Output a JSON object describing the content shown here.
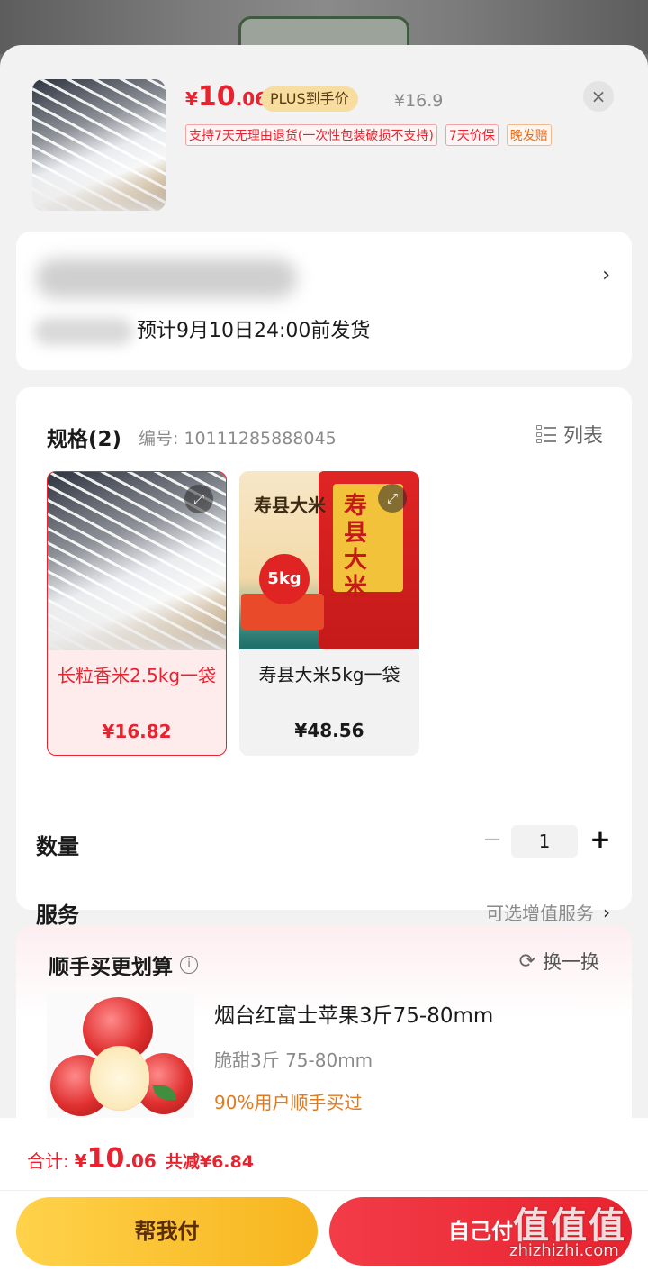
{
  "header": {
    "price_symbol": "¥",
    "price_int": "10",
    "price_dec": ".06",
    "plus_tag": "PLUS到手价",
    "original_price": "¥16.9",
    "close_icon": "×",
    "service_tags": [
      "支持7天无理由退货(一次性包装破损不支持)",
      "7天价保",
      "晚发赔"
    ]
  },
  "address": {
    "shipping_note": "预计9月10日24:00前发货"
  },
  "spec": {
    "title": "规格(2)",
    "code": "编号: 10111285888045",
    "list_label": "列表",
    "options": [
      {
        "name": "长粒香米2.5kg一袋",
        "price": "¥16.82",
        "selected": true
      },
      {
        "name": "寿县大米5kg一袋",
        "price": "¥48.56",
        "selected": false
      }
    ],
    "bag_text_a": "寿县大米",
    "bag_text_b": "寿县大米",
    "bag_weight": "5kg"
  },
  "quantity": {
    "label": "数量",
    "value": "1",
    "minus": "−",
    "plus": "+"
  },
  "service": {
    "label": "服务",
    "link": "可选增值服务"
  },
  "upsell": {
    "title": "顺手买更划算",
    "swap_label": "换一换",
    "product_name": "烟台红富士苹果3斤75-80mm",
    "product_spec": "脆甜3斤 75-80mm",
    "product_stat": "90%用户顺手买过"
  },
  "footer": {
    "total_label": "合计:",
    "total_symbol": "¥",
    "total_int": "10",
    "total_dec": ".06",
    "total_save": "共减¥6.84",
    "help_pay": "帮我付",
    "self_pay": "自己付"
  },
  "watermark": {
    "glyphs": "值值值",
    "url": "zhizhizhi.com"
  },
  "colors": {
    "accent_red": "#e8232f",
    "plus_gold": "#f7dea0",
    "help_button": "#f7b51f",
    "self_button": "#e8232f"
  }
}
